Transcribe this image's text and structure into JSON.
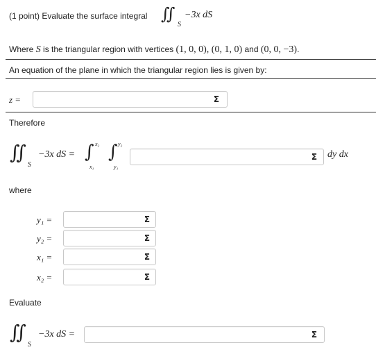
{
  "problem": {
    "intro": "(1 point) Evaluate the surface integral",
    "integrand": "−3x dS",
    "surface_sub": "S",
    "where_text": "Where",
    "where_var": "S",
    "where_rest": "is the triangular region with vertices",
    "vertices": "(1, 0, 0), (0, 1, 0)",
    "and_text": "and",
    "vertex3": "(0, 0, −3)",
    "plane_prompt": "An equation of the plane in which the triangular region lies is given by:"
  },
  "plane": {
    "label": "z =",
    "value": ""
  },
  "therefore": {
    "label": "Therefore",
    "lhs": "−3x dS =",
    "upper_x": "x₂",
    "lower_x": "x₁",
    "upper_y": "y₂",
    "lower_y": "y₁",
    "value": "",
    "differentials": "dy dx"
  },
  "where": {
    "label": "where",
    "fields": [
      {
        "label": "y₁ =",
        "value": ""
      },
      {
        "label": "y₂ =",
        "value": ""
      },
      {
        "label": "x₁ =",
        "value": ""
      },
      {
        "label": "x₂ =",
        "value": ""
      }
    ]
  },
  "evaluate": {
    "label": "Evaluate",
    "lhs": "−3x dS =",
    "value": ""
  },
  "icons": {
    "equation_editor": "sigma-icon"
  }
}
